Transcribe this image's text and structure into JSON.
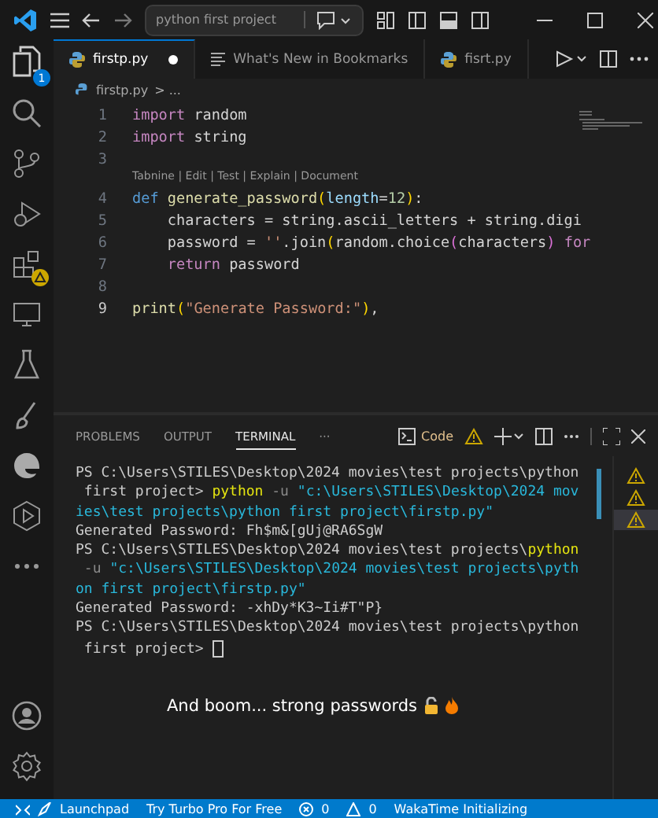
{
  "title_bar": {
    "search": "python first project"
  },
  "activity_bar": {
    "explorer_badge": "1"
  },
  "tabs": [
    {
      "label": "firstp.py",
      "kind": "python",
      "selected": true,
      "modified": true
    },
    {
      "label": "What's New in Bookmarks",
      "kind": "doc",
      "selected": false,
      "modified": false
    },
    {
      "label": "fisrt.py",
      "kind": "python",
      "selected": false,
      "modified": false
    }
  ],
  "breadcrumb": {
    "file": "firstp.py",
    "rest": "> ..."
  },
  "editor": {
    "lines": [
      {
        "number": "1",
        "current": false,
        "tokens": [
          {
            "kind": "keyword",
            "text": "import"
          },
          {
            "kind": "plain",
            "text": " random"
          }
        ]
      },
      {
        "number": "2",
        "current": false,
        "tokens": [
          {
            "kind": "keyword",
            "text": "import"
          },
          {
            "kind": "plain",
            "text": " string"
          }
        ]
      },
      {
        "number": "3",
        "current": false
      },
      {
        "number": "4",
        "current": false,
        "codelens": "Tabnine | Edit | Test | Explain | Document",
        "tokens": [
          {
            "kind": "def",
            "text": "def"
          },
          {
            "kind": "func",
            "text": " generate_password"
          },
          {
            "kind": "bracket",
            "text": "("
          },
          {
            "kind": "param",
            "text": "length"
          },
          {
            "kind": "plain",
            "text": "="
          },
          {
            "kind": "number",
            "text": "12"
          },
          {
            "kind": "bracket",
            "text": ")"
          },
          {
            "kind": "plain",
            "text": ":"
          }
        ]
      },
      {
        "number": "5",
        "current": false,
        "tokens": [
          {
            "kind": "plain",
            "text": "    characters = string.ascii_letters + string.digi"
          }
        ]
      },
      {
        "number": "6",
        "current": false,
        "tokens": [
          {
            "kind": "plain",
            "text": "    password = "
          },
          {
            "kind": "string",
            "text": "''"
          },
          {
            "kind": "plain",
            "text": ".join"
          },
          {
            "kind": "bracket",
            "text": "("
          },
          {
            "kind": "plain",
            "text": "random.choice"
          },
          {
            "kind": "bracket2",
            "text": "("
          },
          {
            "kind": "plain",
            "text": "characters"
          },
          {
            "kind": "bracket2",
            "text": ")"
          },
          {
            "kind": "keyword",
            "text": " for"
          }
        ]
      },
      {
        "number": "7",
        "current": false,
        "tokens": [
          {
            "kind": "keyword",
            "text": "    return"
          },
          {
            "kind": "plain",
            "text": " password"
          }
        ]
      },
      {
        "number": "8",
        "current": false
      },
      {
        "number": "9",
        "current": true,
        "tokens": [
          {
            "kind": "func",
            "text": "print"
          },
          {
            "kind": "bracket",
            "text": "("
          },
          {
            "kind": "string",
            "text": "\"Generate Password:\""
          },
          {
            "kind": "bracket",
            "text": ")"
          },
          {
            "kind": "plain",
            "text": ","
          }
        ]
      }
    ]
  },
  "panel": {
    "tabs": [
      {
        "label": "PROBLEMS",
        "selected": false
      },
      {
        "label": "OUTPUT",
        "selected": false
      },
      {
        "label": "TERMINAL",
        "selected": true
      }
    ],
    "more": "···",
    "terminal_name": "Code"
  },
  "terminal": {
    "lines": [
      [
        {
          "kind": "plain",
          "text": "PS C:\\Users\\STILES\\Desktop\\2024 movies\\test projects\\python"
        }
      ],
      [
        {
          "kind": "plain",
          "text": " first project> "
        },
        {
          "kind": "cmd",
          "text": "python"
        },
        {
          "kind": "flag",
          "text": " -u "
        },
        {
          "kind": "string",
          "text": "\"c:\\Users\\STILES\\Desktop\\2024 mov"
        }
      ],
      [
        {
          "kind": "string",
          "text": "ies\\test projects\\python first project\\firstp.py\""
        }
      ],
      [
        {
          "kind": "plain",
          "text": "Generated Password: Fh$m&[gUj@RA6SgW"
        }
      ],
      [
        {
          "kind": "plain",
          "text": "PS C:\\Users\\STILES\\Desktop\\2024 movies\\test projects\\"
        },
        {
          "kind": "cmd",
          "text": "python"
        }
      ],
      [
        {
          "kind": "flag",
          "text": " -u "
        },
        {
          "kind": "string",
          "text": "\"c:\\Users\\STILES\\Desktop\\2024 movies\\test projects\\pyth"
        }
      ],
      [
        {
          "kind": "string",
          "text": "on first project\\firstp.py\""
        }
      ],
      [
        {
          "kind": "plain",
          "text": "Generated Password: -xhDy*K3~Ii#T\"P}"
        }
      ],
      [
        {
          "kind": "plain",
          "text": "PS C:\\Users\\STILES\\Desktop\\2024 movies\\test projects\\python"
        }
      ],
      [
        {
          "kind": "plain",
          "text": " first project> "
        },
        {
          "kind": "cursor"
        }
      ]
    ]
  },
  "caption": "And boom... strong passwords",
  "status_bar": {
    "launchpad": "Launchpad",
    "turbo": "Try Turbo Pro For Free",
    "errors": "0",
    "warnings": "0",
    "wakatime": "WakaTime Initializing"
  }
}
